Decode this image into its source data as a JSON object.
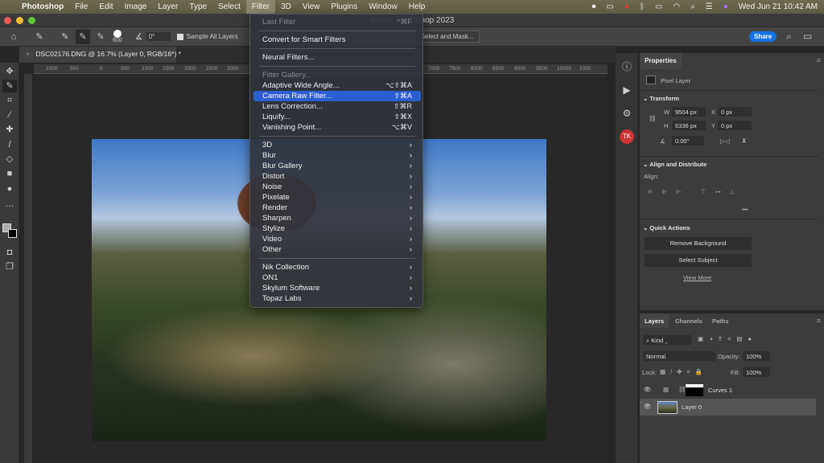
{
  "menubar": {
    "items": [
      "Photoshop",
      "File",
      "Edit",
      "Image",
      "Layer",
      "Type",
      "Select",
      "Filter",
      "3D",
      "View",
      "Plugins",
      "Window",
      "Help"
    ],
    "active": "Filter",
    "clock": "Wed Jun 21  10:42 AM"
  },
  "window": {
    "title": "Adobe Photoshop 2023"
  },
  "options": {
    "brush_size": "600",
    "angle": "0°",
    "sample_all_layers": "Sample All Layers",
    "sample_all_checked": true,
    "select_mask": "Select and Mask...",
    "share": "Share"
  },
  "document": {
    "tab": "DSC02176.DNG @ 16.7% (Layer 0, RGB/16*) *",
    "close": "×"
  },
  "ruler": [
    "1000",
    "500",
    "0",
    "500",
    "1000",
    "1500",
    "2000",
    "2500",
    "3000",
    "7000",
    "7500",
    "8000",
    "8500",
    "9000",
    "9500",
    "10000",
    "1050"
  ],
  "filter_menu": {
    "items": [
      {
        "label": "Last Filter",
        "shortcut": "^⌘F",
        "disabled": true
      },
      {
        "sep": true
      },
      {
        "label": "Convert for Smart Filters"
      },
      {
        "sep": true
      },
      {
        "label": "Neural Filters..."
      },
      {
        "sep": true
      },
      {
        "label": "Filter Gallery...",
        "disabled": true
      },
      {
        "label": "Adaptive Wide Angle...",
        "shortcut": "⌥⇧⌘A"
      },
      {
        "label": "Camera Raw Filter...",
        "shortcut": "⇧⌘A",
        "highlighted": true
      },
      {
        "label": "Lens Correction...",
        "shortcut": "⇧⌘R"
      },
      {
        "label": "Liquify...",
        "shortcut": "⇧⌘X"
      },
      {
        "label": "Vanishing Point...",
        "shortcut": "⌥⌘V"
      },
      {
        "sep": true
      },
      {
        "label": "3D",
        "submenu": true
      },
      {
        "label": "Blur",
        "submenu": true
      },
      {
        "label": "Blur Gallery",
        "submenu": true
      },
      {
        "label": "Distort",
        "submenu": true
      },
      {
        "label": "Noise",
        "submenu": true
      },
      {
        "label": "Pixelate",
        "submenu": true
      },
      {
        "label": "Render",
        "submenu": true
      },
      {
        "label": "Sharpen",
        "submenu": true
      },
      {
        "label": "Stylize",
        "submenu": true
      },
      {
        "label": "Video",
        "submenu": true
      },
      {
        "label": "Other",
        "submenu": true
      },
      {
        "sep": true
      },
      {
        "label": "Nik Collection",
        "submenu": true
      },
      {
        "label": "ON1",
        "submenu": true
      },
      {
        "label": "Skylum Software",
        "submenu": true
      },
      {
        "label": "Topaz Labs",
        "submenu": true
      }
    ],
    "highlight_color": "#2a5fd1"
  },
  "properties": {
    "tab": "Properties",
    "layer_type": "Pixel Layer",
    "transform": "Transform",
    "w_label": "W",
    "w": "9504 px",
    "h_label": "H",
    "h": "6336 px",
    "x_label": "X",
    "x": "0 px",
    "y_label": "Y",
    "y": "0 px",
    "angle": "0.00°",
    "align_title": "Align and Distribute",
    "align_label": "Align:",
    "more": "•••",
    "quick_actions": "Quick Actions",
    "remove_bg": "Remove Background",
    "select_subject": "Select Subject",
    "view_more": "View More"
  },
  "layers": {
    "tabs": [
      "Layers",
      "Channels",
      "Paths"
    ],
    "filter": "Kind",
    "blend": "Normal",
    "opacity_label": "Opacity:",
    "opacity": "100%",
    "lock_label": "Lock:",
    "fill_label": "Fill:",
    "fill": "100%",
    "rows": [
      {
        "name": "Curves 1"
      },
      {
        "name": "Layer 0",
        "selected": true
      }
    ]
  }
}
